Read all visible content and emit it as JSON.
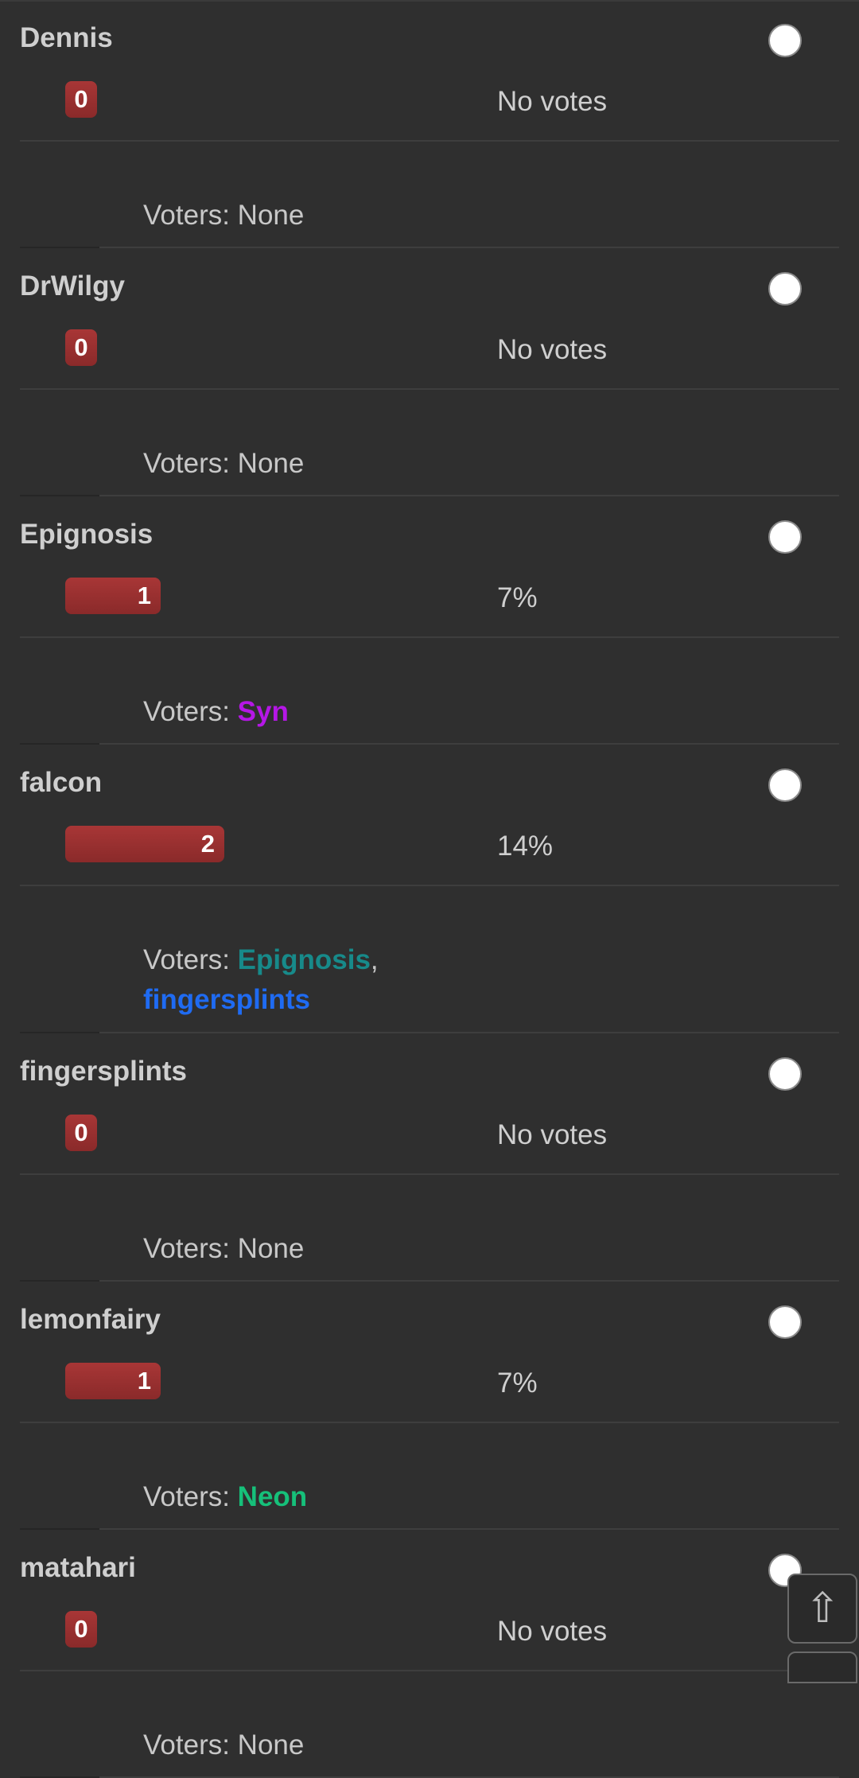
{
  "poll": {
    "voters_prefix": "Voters: ",
    "options": [
      {
        "name": "Dennis",
        "votes": 0,
        "votes_label": "0",
        "percent_text": "No votes",
        "fraction": 0.0,
        "voters": [],
        "voters_none": "None"
      },
      {
        "name": "DrWilgy",
        "votes": 0,
        "votes_label": "0",
        "percent_text": "No votes",
        "fraction": 0.0,
        "voters": [],
        "voters_none": "None"
      },
      {
        "name": "Epignosis",
        "votes": 1,
        "votes_label": "1",
        "percent_text": "7%",
        "fraction": 0.07,
        "voters": [
          {
            "name": "Syn",
            "color": "#b517e6"
          }
        ]
      },
      {
        "name": "falcon",
        "votes": 2,
        "votes_label": "2",
        "percent_text": "14%",
        "fraction": 0.14,
        "voters": [
          {
            "name": "Epignosis",
            "color": "#178a8a"
          },
          {
            "name": "fingersplints",
            "color": "#1f6bf2"
          }
        ]
      },
      {
        "name": "fingersplints",
        "votes": 0,
        "votes_label": "0",
        "percent_text": "No votes",
        "fraction": 0.0,
        "voters": [],
        "voters_none": "None"
      },
      {
        "name": "lemonfairy",
        "votes": 1,
        "votes_label": "1",
        "percent_text": "7%",
        "fraction": 0.07,
        "voters": [
          {
            "name": "Neon",
            "color": "#16c07a"
          }
        ]
      },
      {
        "name": "matahari",
        "votes": 0,
        "votes_label": "0",
        "percent_text": "No votes",
        "fraction": 0.0,
        "voters": [],
        "voters_none": "None"
      }
    ]
  },
  "scroll_top": {
    "icon": "up-arrow-icon",
    "glyph": "⇧"
  },
  "colors": {
    "background": "#2f2f2f",
    "bar": "#9a2f2f",
    "text": "#c8c8c8"
  }
}
